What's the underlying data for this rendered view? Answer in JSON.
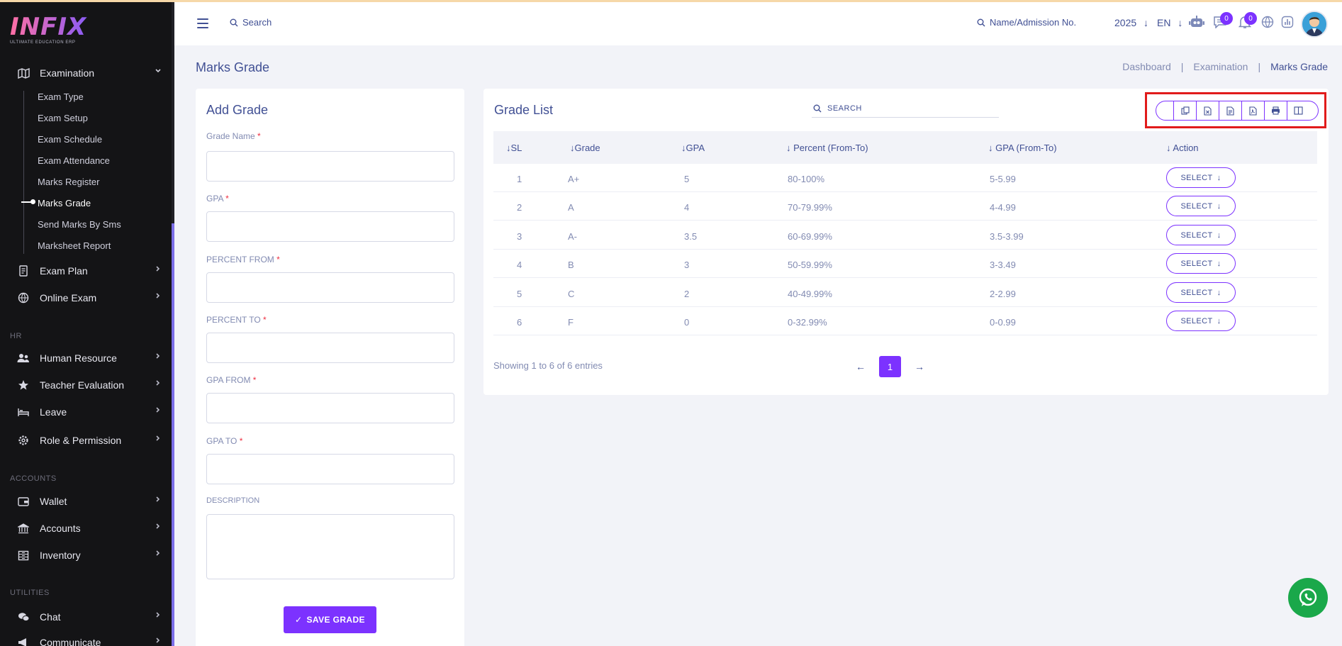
{
  "app": {
    "logo_text": "INFIX",
    "logo_tagline": "ULTIMATE EDUCATION ERP"
  },
  "sidebar": {
    "examination": {
      "label": "Examination",
      "icon": "map-icon"
    },
    "sub_items": [
      {
        "label": "Exam Type"
      },
      {
        "label": "Exam Setup"
      },
      {
        "label": "Exam Schedule"
      },
      {
        "label": "Exam Attendance"
      },
      {
        "label": "Marks Register"
      },
      {
        "label": "Marks Grade",
        "active": true
      },
      {
        "label": "Send Marks By Sms"
      },
      {
        "label": "Marksheet Report"
      }
    ],
    "items": [
      {
        "label": "Exam Plan",
        "icon": "document-icon"
      },
      {
        "label": "Online Exam",
        "icon": "globe-icon"
      },
      {
        "label": "Human Resource",
        "icon": "users-icon"
      },
      {
        "label": "Teacher Evaluation",
        "icon": "star-icon"
      },
      {
        "label": "Leave",
        "icon": "bed-icon"
      },
      {
        "label": "Role & Permission",
        "icon": "gear-icon"
      },
      {
        "label": "Wallet",
        "icon": "wallet-icon"
      },
      {
        "label": "Accounts",
        "icon": "bank-icon"
      },
      {
        "label": "Inventory",
        "icon": "inventory-icon"
      },
      {
        "label": "Chat",
        "icon": "chat-icon"
      },
      {
        "label": "Communicate",
        "icon": "megaphone-icon"
      }
    ],
    "sections": {
      "hr": "HR",
      "accounts": "ACCOUNTS",
      "utilities": "UTILITIES"
    }
  },
  "header": {
    "search_label": "Search",
    "student_search_label": "Name/Admission No.",
    "year": "2025",
    "language": "EN",
    "chat_badge": "0",
    "notification_badge": "0"
  },
  "page": {
    "title": "Marks Grade",
    "breadcrumb": [
      "Dashboard",
      "Examination",
      "Marks Grade"
    ]
  },
  "add_grade": {
    "title": "Add Grade",
    "fields": {
      "grade_name": "Grade Name",
      "gpa": "GPA",
      "percent_from": "PERCENT FROM",
      "percent_to": "PERCENT TO",
      "gpa_from": "GPA FROM",
      "gpa_to": "GPA TO",
      "description": "DESCRIPTION"
    },
    "required_mark": "*",
    "save_label": "SAVE GRADE"
  },
  "grade_list": {
    "title": "Grade List",
    "search_label": "SEARCH",
    "columns": [
      "SL",
      "Grade",
      "GPA",
      "Percent (From-To)",
      "GPA (From-To)",
      "Action"
    ],
    "rows": [
      {
        "sl": "1",
        "grade": "A+",
        "gpa": "5",
        "percent": "80-100%",
        "gpa_range": "5-5.99"
      },
      {
        "sl": "2",
        "grade": "A",
        "gpa": "4",
        "percent": "70-79.99%",
        "gpa_range": "4-4.99"
      },
      {
        "sl": "3",
        "grade": "A-",
        "gpa": "3.5",
        "percent": "60-69.99%",
        "gpa_range": "3.5-3.99"
      },
      {
        "sl": "4",
        "grade": "B",
        "gpa": "3",
        "percent": "50-59.99%",
        "gpa_range": "3-3.49"
      },
      {
        "sl": "5",
        "grade": "C",
        "gpa": "2",
        "percent": "40-49.99%",
        "gpa_range": "2-2.99"
      },
      {
        "sl": "6",
        "grade": "F",
        "gpa": "0",
        "percent": "0-32.99%",
        "gpa_range": "0-0.99"
      }
    ],
    "select_label": "SELECT",
    "showing": "Showing 1 to 6 of 6 entries",
    "current_page": "1",
    "export_buttons": [
      "copy-icon",
      "excel-icon",
      "csv-icon",
      "pdf-icon",
      "print-icon",
      "columns-icon"
    ]
  },
  "colors": {
    "accent": "#7c32ff",
    "text": "#415094",
    "muted": "#828bb2",
    "sidebar": "#141416",
    "highlight": "#e11b1b"
  }
}
